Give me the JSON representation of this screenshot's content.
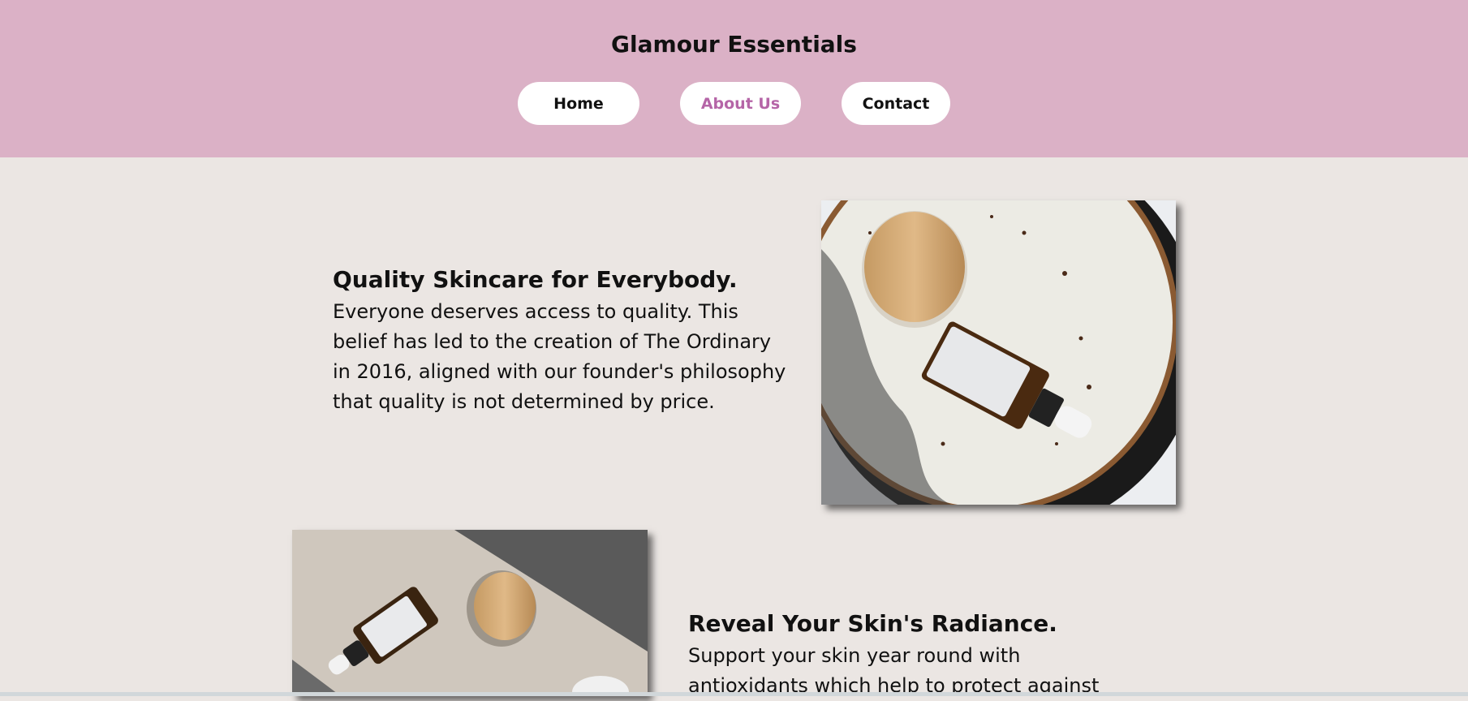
{
  "header": {
    "title": "Glamour Essentials",
    "nav": [
      {
        "label": "Home",
        "active": false
      },
      {
        "label": "About Us",
        "active": true
      },
      {
        "label": "Contact",
        "active": false
      }
    ],
    "background_color": "#dbb1c6",
    "active_color": "#b565a7"
  },
  "sections": [
    {
      "title": "Quality Skincare for Everybody.",
      "text": "Everyone deserves access to quality. This belief has led to the creation of The Ordinary in 2016, aligned with our founder's philosophy that quality is not determined by price.",
      "image_icon": "skincare-products-photo"
    },
    {
      "title": "Reveal Your Skin's Radiance.",
      "text": "Support your skin year round with antioxidants which help to protect against",
      "image_icon": "skincare-products-photo"
    }
  ],
  "page_background": "#ebe6e3"
}
